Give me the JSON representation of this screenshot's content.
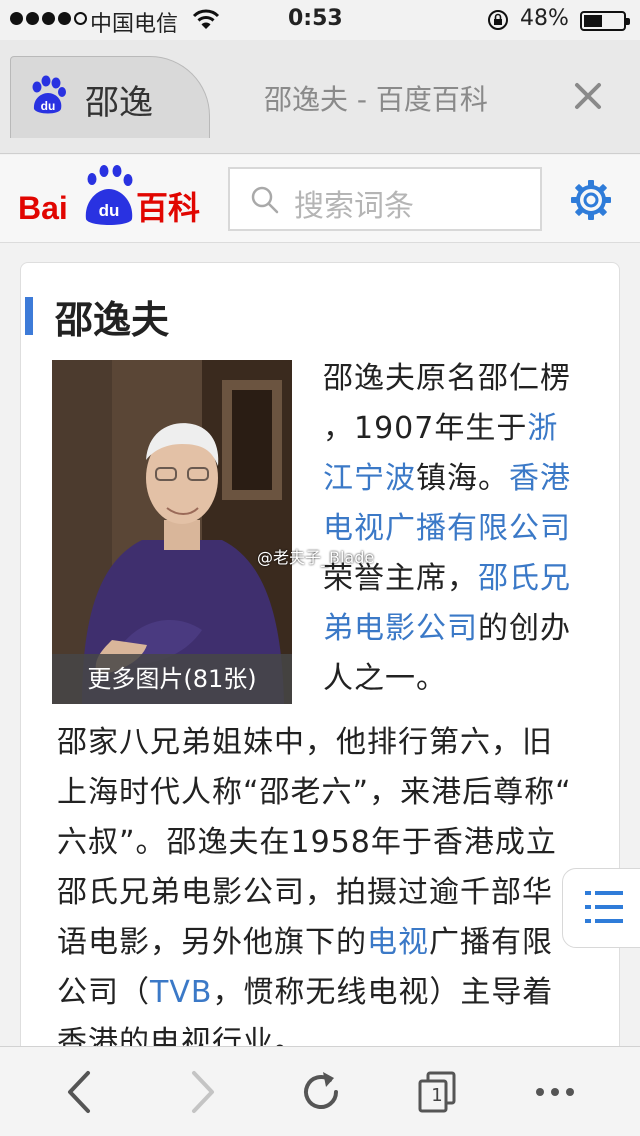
{
  "status_bar": {
    "carrier": "中国电信",
    "time": "0:53",
    "battery_percent_text": "48%",
    "battery_level": 0.48
  },
  "tab_bar": {
    "active_tab_label": "邵逸",
    "page_title": "邵逸夫 - 百度百科"
  },
  "header": {
    "logo_text": "Bai du 百科",
    "search_placeholder": "搜索词条"
  },
  "article": {
    "title": "邵逸夫",
    "photo_caption": "更多图片(81张)",
    "photo_watermark": "@老夫子_Blade",
    "para1": [
      [
        {
          "t": "邵逸夫原名邵仁楞"
        }
      ],
      [
        {
          "t": "，1907年生于"
        },
        {
          "t": "浙",
          "link": true
        }
      ],
      [
        {
          "t": "江宁波",
          "link": true
        },
        {
          "t": "镇海。"
        },
        {
          "t": "香港",
          "link": true
        }
      ],
      [
        {
          "t": "电视广播有限公司",
          "link": true
        }
      ],
      [
        {
          "t": "荣誉主席，"
        },
        {
          "t": "邵氏兄",
          "link": true
        }
      ],
      [
        {
          "t": "弟电影公司",
          "link": true
        },
        {
          "t": "的创办"
        }
      ],
      [
        {
          "t": "人之一。"
        }
      ]
    ],
    "para2": [
      [
        {
          "t": "邵家八兄弟姐妹中，他排行第六，旧"
        }
      ],
      [
        {
          "t": "上海时代人称“邵老六”，来港后尊称“"
        }
      ],
      [
        {
          "t": "六叔”。邵逸夫在1958年于香港成立"
        }
      ],
      [
        {
          "t": "邵氏兄弟电影公司，拍摄过逾千部华"
        }
      ],
      [
        {
          "t": "语电影，另外他旗下的"
        },
        {
          "t": "电视",
          "link": true
        },
        {
          "t": "广播有限"
        }
      ],
      [
        {
          "t": "公司（"
        },
        {
          "t": "TVB",
          "link": true
        },
        {
          "t": "，惯称无线电视）主导着"
        }
      ],
      [
        {
          "t": "香港的电视行业。"
        }
      ]
    ]
  },
  "toolbar": {
    "tab_count": "1"
  },
  "colors": {
    "link": "#3b79c7",
    "accent_bar": "#3d7bd8",
    "baidu_red": "#e10601",
    "baidu_blue": "#2932e1"
  },
  "icons": [
    "signal-icon",
    "wifi-icon",
    "rotation-lock-icon",
    "battery-icon",
    "baidu-paw-icon",
    "close-icon",
    "search-icon",
    "gear-icon",
    "toc-list-icon",
    "back-arrow-icon",
    "forward-arrow-icon",
    "reload-icon",
    "tabs-icon",
    "more-icon"
  ]
}
